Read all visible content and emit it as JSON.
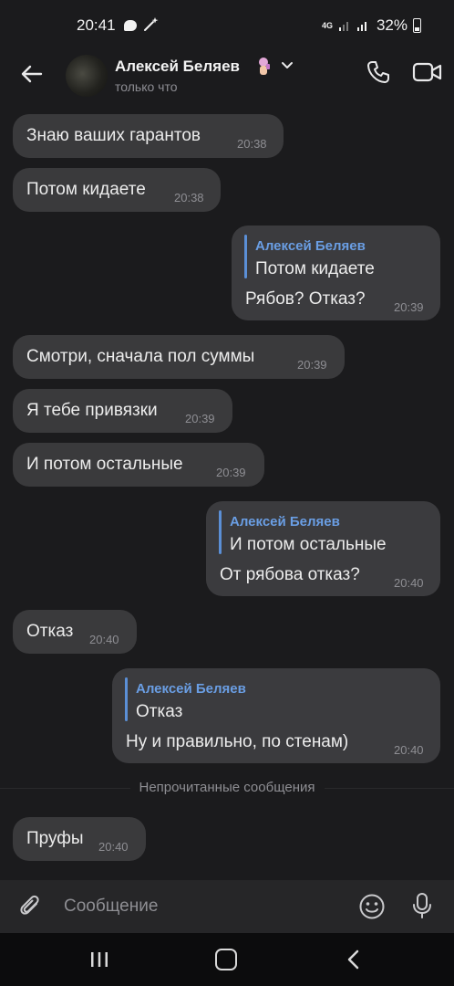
{
  "status_bar": {
    "time": "20:41",
    "network": "4G",
    "battery": "32%"
  },
  "header": {
    "contact_name": "Алексей Беляев",
    "status": "только что",
    "icons": [
      "back-arrow-icon",
      "avatar",
      "chevron-down-icon",
      "phone-icon",
      "video-camera-icon"
    ]
  },
  "messages": [
    {
      "dir": "in",
      "text": "Знаю ваших гарантов",
      "time": "20:38"
    },
    {
      "dir": "in",
      "text": "Потом кидаете",
      "time": "20:38"
    },
    {
      "dir": "out",
      "reply_name": "Алексей Беляев",
      "reply_text": "Потом кидаете",
      "text": "Рябов? Отказ?",
      "time": "20:39"
    },
    {
      "dir": "in",
      "text": "Смотри, сначала пол суммы",
      "time": "20:39"
    },
    {
      "dir": "in",
      "text": "Я тебе привязки",
      "time": "20:39"
    },
    {
      "dir": "in",
      "text": "И потом остальные",
      "time": "20:39"
    },
    {
      "dir": "out",
      "reply_name": "Алексей Беляев",
      "reply_text": "И потом остальные",
      "text": "От рябова отказ?",
      "time": "20:40"
    },
    {
      "dir": "in",
      "text": "Отказ",
      "time": "20:40"
    },
    {
      "dir": "out",
      "reply_name": "Алексей Беляев",
      "reply_text": "Отказ",
      "text": "Ну и правильно, по стенам)",
      "time": "20:40"
    },
    {
      "dir": "in",
      "text": "Пруфы",
      "time": "20:40"
    }
  ],
  "unread_divider": "Непрочитанные сообщения",
  "composer": {
    "placeholder": "Сообщение"
  },
  "colors": {
    "background": "#1b1b1d",
    "bubble": "#3a3a3c",
    "reply_accent": "#6a9ee4"
  }
}
